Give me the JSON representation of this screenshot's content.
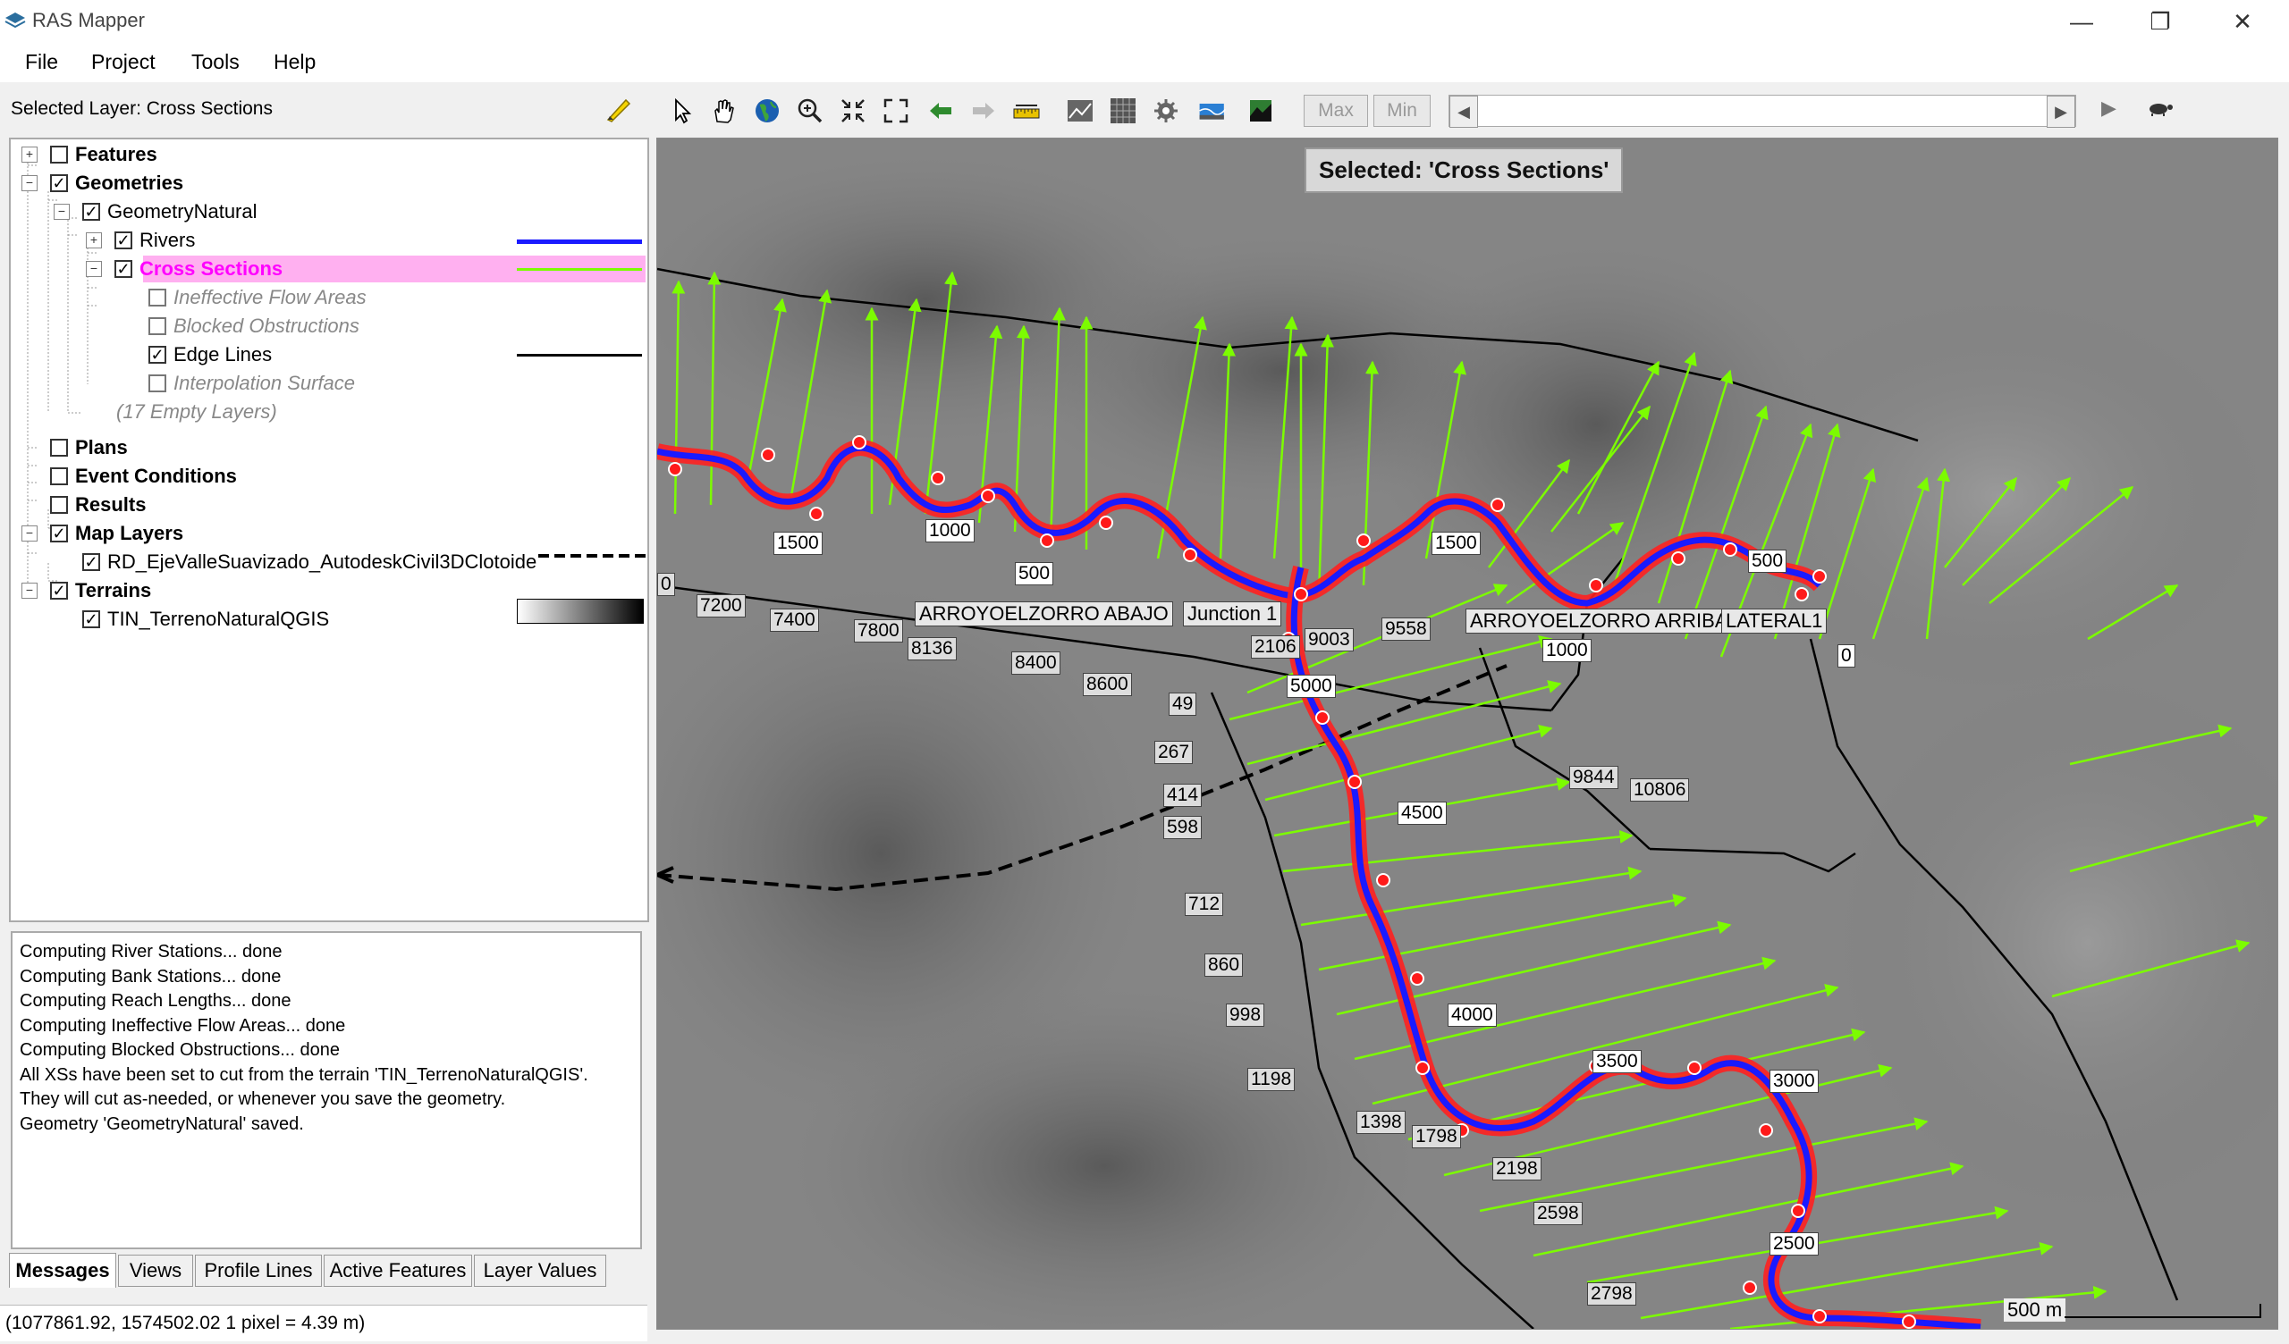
{
  "window": {
    "title": "RAS Mapper",
    "minimize": "—",
    "restore": "❐",
    "close": "✕"
  },
  "menu": [
    "File",
    "Project",
    "Tools",
    "Help"
  ],
  "selected_layer": "Selected Layer: Cross Sections",
  "toolbar": {
    "max_label": "Max",
    "min_label": "Min",
    "icons": [
      "select-arrow-icon",
      "pan-hand-icon",
      "globe-icon",
      "zoom-in-icon",
      "zoom-extents-icon",
      "full-extent-icon",
      "back-arrow-icon",
      "forward-arrow-icon",
      "measure-ruler-icon",
      "profile-plot-icon",
      "grid-icon",
      "gear-icon",
      "map-layer-icon",
      "terrain-icon"
    ],
    "play_icon": "▶",
    "turtle_icon": "🐢"
  },
  "tree": {
    "features": "Features",
    "geometries": "Geometries",
    "geometry_natural": "GeometryNatural",
    "rivers": "Rivers",
    "cross_sections": "Cross Sections",
    "ineffective": "Ineffective Flow Areas",
    "blocked": "Blocked Obstructions",
    "edge_lines": "Edge Lines",
    "interp_surface": "Interpolation Surface",
    "empty_layers": "(17 Empty Layers)",
    "plans": "Plans",
    "event_conditions": "Event Conditions",
    "results": "Results",
    "map_layers": "Map Layers",
    "map_layer_item": "RD_EjeValleSuavizado_AutodeskCivil3DClotoide",
    "terrains": "Terrains",
    "terrain_item": "TIN_TerrenoNaturalQGIS"
  },
  "messages": [
    "Computing River Stations... done",
    "Computing Bank Stations... done",
    "Computing Reach Lengths... done",
    "Computing Ineffective Flow Areas... done",
    "Computing Blocked Obstructions... done",
    "All XSs have been set to cut from the terrain 'TIN_TerrenoNaturalQGIS'. They will cut as-needed, or whenever you save the geometry.",
    "Geometry 'GeometryNatural' saved."
  ],
  "tabs": [
    "Messages",
    "Views",
    "Profile Lines",
    "Active Features",
    "Layer Values"
  ],
  "status": "(1077861.92, 1574502.02  1 pixel = 4.39 m)",
  "map": {
    "selected_banner": "Selected: 'Cross Sections'",
    "scale": "500 m",
    "reach_labels": [
      "ARROYOELZORRO   ABAJO",
      "Junction 1",
      "ARROYOELZORRO   ARRIBA",
      "LATERAL1"
    ],
    "station_labels": [
      "1500",
      "1000",
      "500",
      "1500",
      "500",
      "0",
      "7200",
      "7400",
      "7800",
      "8136",
      "8400",
      "8600",
      "49",
      "267",
      "414",
      "598",
      "712",
      "860",
      "998",
      "1198",
      "1398",
      "1798",
      "2198",
      "2598",
      "2798",
      "1000",
      "4500",
      "5000",
      "4000",
      "3500",
      "3000",
      "2500",
      "9003",
      "9558",
      "9844",
      "10806",
      "2106",
      "0"
    ],
    "colors": {
      "river": "#1a1aff",
      "cross_section": "#7cfc00",
      "edge_line": "#000000",
      "highlight": "#ff00ff",
      "selection_bg": "#ffb0f0"
    }
  }
}
